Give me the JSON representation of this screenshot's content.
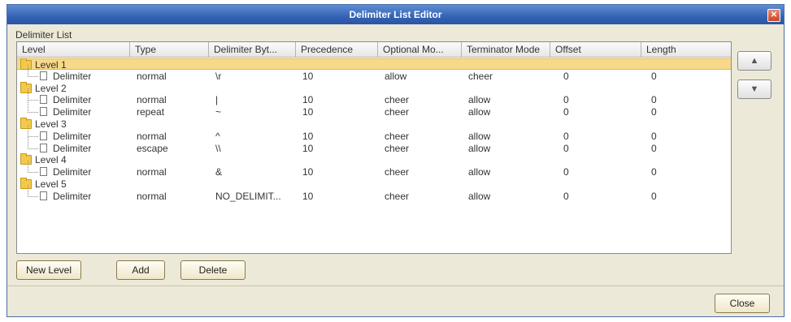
{
  "window": {
    "title": "Delimiter List Editor"
  },
  "group_label": "Delimiter List",
  "columns": [
    "Level",
    "Type",
    "Delimiter Byt...",
    "Precedence",
    "Optional Mo...",
    "Terminator Mode",
    "Offset",
    "Length"
  ],
  "rows": [
    {
      "kind": "level",
      "label": "Level 1",
      "selected": true
    },
    {
      "kind": "delim",
      "label": "Delimiter",
      "type": "normal",
      "bytes": "\\r",
      "precedence": "10",
      "optional": "allow",
      "terminator": "cheer",
      "offset": "0",
      "length": "0"
    },
    {
      "kind": "level",
      "label": "Level 2"
    },
    {
      "kind": "delim",
      "label": "Delimiter",
      "type": "normal",
      "bytes": "|",
      "precedence": "10",
      "optional": "cheer",
      "terminator": "allow",
      "offset": "0",
      "length": "0"
    },
    {
      "kind": "delim",
      "label": "Delimiter",
      "type": "repeat",
      "bytes": "~",
      "precedence": "10",
      "optional": "cheer",
      "terminator": "allow",
      "offset": "0",
      "length": "0"
    },
    {
      "kind": "level",
      "label": "Level 3"
    },
    {
      "kind": "delim",
      "label": "Delimiter",
      "type": "normal",
      "bytes": "^",
      "precedence": "10",
      "optional": "cheer",
      "terminator": "allow",
      "offset": "0",
      "length": "0"
    },
    {
      "kind": "delim",
      "label": "Delimiter",
      "type": "escape",
      "bytes": "\\\\",
      "precedence": "10",
      "optional": "cheer",
      "terminator": "allow",
      "offset": "0",
      "length": "0"
    },
    {
      "kind": "level",
      "label": "Level 4"
    },
    {
      "kind": "delim",
      "label": "Delimiter",
      "type": "normal",
      "bytes": "&",
      "precedence": "10",
      "optional": "cheer",
      "terminator": "allow",
      "offset": "0",
      "length": "0"
    },
    {
      "kind": "level",
      "label": "Level 5"
    },
    {
      "kind": "delim",
      "label": "Delimiter",
      "type": "normal",
      "bytes": "NO_DELIMIT...",
      "precedence": "10",
      "optional": "cheer",
      "terminator": "allow",
      "offset": "0",
      "length": "0"
    }
  ],
  "buttons": {
    "new_level": "New Level",
    "add": "Add",
    "delete": "Delete",
    "close": "Close"
  },
  "side_buttons": {
    "up": "▲",
    "down": "▼"
  },
  "close_glyph": "✕"
}
